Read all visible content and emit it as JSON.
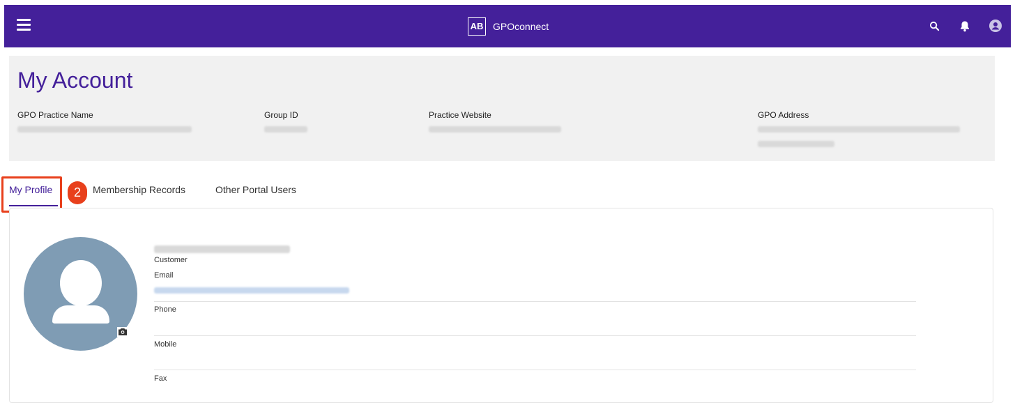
{
  "topbar": {
    "menu_icon": "hamburger-menu-icon",
    "logo_text": "AB",
    "app_name": "GPOconnect",
    "icons": [
      "search-icon",
      "bell-icon",
      "user-avatar-icon"
    ],
    "color": "#44209a"
  },
  "account": {
    "title": "My Account",
    "fields": {
      "practice_name_label": "GPO Practice Name",
      "group_id_label": "Group ID",
      "website_label": "Practice Website",
      "address_label": "GPO Address"
    }
  },
  "tabs": {
    "items": [
      "My Profile",
      "Membership Records",
      "Other Portal Users"
    ],
    "active": "My Profile"
  },
  "step_badge": "2",
  "profile": {
    "role": "Customer",
    "email_label": "Email",
    "phone_label": "Phone",
    "mobile_label": "Mobile",
    "fax_label": "Fax"
  },
  "colors": {
    "accent": "#44209a",
    "highlight": "#e8401c",
    "avatar_bg": "#7f9cb4"
  }
}
